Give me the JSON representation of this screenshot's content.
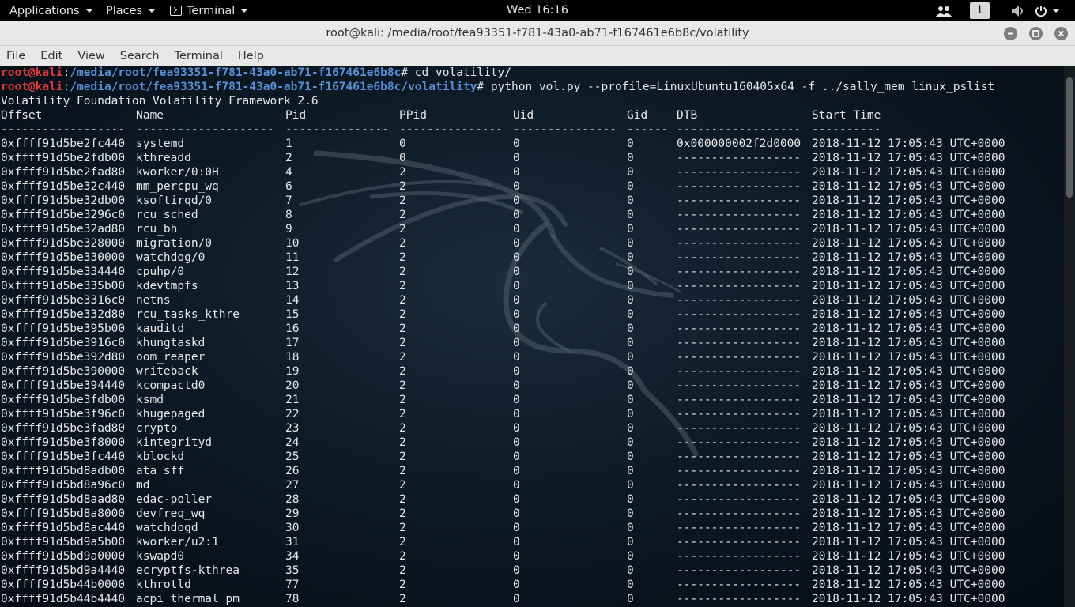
{
  "topbar": {
    "applications": "Applications",
    "places": "Places",
    "terminal": "Terminal",
    "clock": "Wed 16:16",
    "workspace": "1"
  },
  "window": {
    "title": "root@kali: /media/root/fea93351-f781-43a0-ab71-f167461e6b8c/volatility",
    "menu": [
      "File",
      "Edit",
      "View",
      "Search",
      "Terminal",
      "Help"
    ]
  },
  "prompt1": {
    "user": "root@kali",
    "sep": ":",
    "path": "/media/root/fea93351-f781-43a0-ab71-f167461e6b8c",
    "cmd": "# cd volatility/"
  },
  "prompt2": {
    "user": "root@kali",
    "sep": ":",
    "path": "/media/root/fea93351-f781-43a0-ab71-f167461e6b8c/volatility",
    "cmd": "# python vol.py --profile=LinuxUbuntu160405x64 -f ../sally_mem linux_pslist"
  },
  "banner": "Volatility Foundation Volatility Framework 2.6",
  "table": {
    "headers": [
      "Offset",
      "Name",
      "Pid",
      "PPid",
      "Uid",
      "Gid",
      "DTB",
      "Start Time"
    ],
    "dashes": [
      "------------------",
      "--------------------",
      "---------------",
      "---------------",
      "---------------",
      "------",
      "------------------",
      "----------"
    ],
    "rows": [
      [
        "0xffff91d5be2fc440",
        "systemd",
        "1",
        "0",
        "0",
        "0",
        "0x000000002f2d0000",
        "2018-11-12 17:05:43 UTC+0000"
      ],
      [
        "0xffff91d5be2fdb00",
        "kthreadd",
        "2",
        "0",
        "0",
        "0",
        "------------------",
        "2018-11-12 17:05:43 UTC+0000"
      ],
      [
        "0xffff91d5be2fad80",
        "kworker/0:0H",
        "4",
        "2",
        "0",
        "0",
        "------------------",
        "2018-11-12 17:05:43 UTC+0000"
      ],
      [
        "0xffff91d5be32c440",
        "mm_percpu_wq",
        "6",
        "2",
        "0",
        "0",
        "------------------",
        "2018-11-12 17:05:43 UTC+0000"
      ],
      [
        "0xffff91d5be32db00",
        "ksoftirqd/0",
        "7",
        "2",
        "0",
        "0",
        "------------------",
        "2018-11-12 17:05:43 UTC+0000"
      ],
      [
        "0xffff91d5be3296c0",
        "rcu_sched",
        "8",
        "2",
        "0",
        "0",
        "------------------",
        "2018-11-12 17:05:43 UTC+0000"
      ],
      [
        "0xffff91d5be32ad80",
        "rcu_bh",
        "9",
        "2",
        "0",
        "0",
        "------------------",
        "2018-11-12 17:05:43 UTC+0000"
      ],
      [
        "0xffff91d5be328000",
        "migration/0",
        "10",
        "2",
        "0",
        "0",
        "------------------",
        "2018-11-12 17:05:43 UTC+0000"
      ],
      [
        "0xffff91d5be330000",
        "watchdog/0",
        "11",
        "2",
        "0",
        "0",
        "------------------",
        "2018-11-12 17:05:43 UTC+0000"
      ],
      [
        "0xffff91d5be334440",
        "cpuhp/0",
        "12",
        "2",
        "0",
        "0",
        "------------------",
        "2018-11-12 17:05:43 UTC+0000"
      ],
      [
        "0xffff91d5be335b00",
        "kdevtmpfs",
        "13",
        "2",
        "0",
        "0",
        "------------------",
        "2018-11-12 17:05:43 UTC+0000"
      ],
      [
        "0xffff91d5be3316c0",
        "netns",
        "14",
        "2",
        "0",
        "0",
        "------------------",
        "2018-11-12 17:05:43 UTC+0000"
      ],
      [
        "0xffff91d5be332d80",
        "rcu_tasks_kthre",
        "15",
        "2",
        "0",
        "0",
        "------------------",
        "2018-11-12 17:05:43 UTC+0000"
      ],
      [
        "0xffff91d5be395b00",
        "kauditd",
        "16",
        "2",
        "0",
        "0",
        "------------------",
        "2018-11-12 17:05:43 UTC+0000"
      ],
      [
        "0xffff91d5be3916c0",
        "khungtaskd",
        "17",
        "2",
        "0",
        "0",
        "------------------",
        "2018-11-12 17:05:43 UTC+0000"
      ],
      [
        "0xffff91d5be392d80",
        "oom_reaper",
        "18",
        "2",
        "0",
        "0",
        "------------------",
        "2018-11-12 17:05:43 UTC+0000"
      ],
      [
        "0xffff91d5be390000",
        "writeback",
        "19",
        "2",
        "0",
        "0",
        "------------------",
        "2018-11-12 17:05:43 UTC+0000"
      ],
      [
        "0xffff91d5be394440",
        "kcompactd0",
        "20",
        "2",
        "0",
        "0",
        "------------------",
        "2018-11-12 17:05:43 UTC+0000"
      ],
      [
        "0xffff91d5be3fdb00",
        "ksmd",
        "21",
        "2",
        "0",
        "0",
        "------------------",
        "2018-11-12 17:05:43 UTC+0000"
      ],
      [
        "0xffff91d5be3f96c0",
        "khugepaged",
        "22",
        "2",
        "0",
        "0",
        "------------------",
        "2018-11-12 17:05:43 UTC+0000"
      ],
      [
        "0xffff91d5be3fad80",
        "crypto",
        "23",
        "2",
        "0",
        "0",
        "------------------",
        "2018-11-12 17:05:43 UTC+0000"
      ],
      [
        "0xffff91d5be3f8000",
        "kintegrityd",
        "24",
        "2",
        "0",
        "0",
        "------------------",
        "2018-11-12 17:05:43 UTC+0000"
      ],
      [
        "0xffff91d5be3fc440",
        "kblockd",
        "25",
        "2",
        "0",
        "0",
        "------------------",
        "2018-11-12 17:05:43 UTC+0000"
      ],
      [
        "0xffff91d5bd8adb00",
        "ata_sff",
        "26",
        "2",
        "0",
        "0",
        "------------------",
        "2018-11-12 17:05:43 UTC+0000"
      ],
      [
        "0xffff91d5bd8a96c0",
        "md",
        "27",
        "2",
        "0",
        "0",
        "------------------",
        "2018-11-12 17:05:43 UTC+0000"
      ],
      [
        "0xffff91d5bd8aad80",
        "edac-poller",
        "28",
        "2",
        "0",
        "0",
        "------------------",
        "2018-11-12 17:05:43 UTC+0000"
      ],
      [
        "0xffff91d5bd8a8000",
        "devfreq_wq",
        "29",
        "2",
        "0",
        "0",
        "------------------",
        "2018-11-12 17:05:43 UTC+0000"
      ],
      [
        "0xffff91d5bd8ac440",
        "watchdogd",
        "30",
        "2",
        "0",
        "0",
        "------------------",
        "2018-11-12 17:05:43 UTC+0000"
      ],
      [
        "0xffff91d5bd9a5b00",
        "kworker/u2:1",
        "31",
        "2",
        "0",
        "0",
        "------------------",
        "2018-11-12 17:05:43 UTC+0000"
      ],
      [
        "0xffff91d5bd9a0000",
        "kswapd0",
        "34",
        "2",
        "0",
        "0",
        "------------------",
        "2018-11-12 17:05:43 UTC+0000"
      ],
      [
        "0xffff91d5bd9a4440",
        "ecryptfs-kthrea",
        "35",
        "2",
        "0",
        "0",
        "------------------",
        "2018-11-12 17:05:43 UTC+0000"
      ],
      [
        "0xffff91d5b44b0000",
        "kthrotld",
        "77",
        "2",
        "0",
        "0",
        "------------------",
        "2018-11-12 17:05:43 UTC+0000"
      ],
      [
        "0xffff91d5b44b4440",
        "acpi_thermal_pm",
        "78",
        "2",
        "0",
        "0",
        "------------------",
        "2018-11-12 17:05:43 UTC+0000"
      ]
    ]
  },
  "icons": {
    "term_app": "terminal-icon",
    "people": "people-icon",
    "volume": "volume-icon",
    "power": "power-icon",
    "minimize": "minimize-icon",
    "maximize": "maximize-icon",
    "close": "close-icon"
  }
}
